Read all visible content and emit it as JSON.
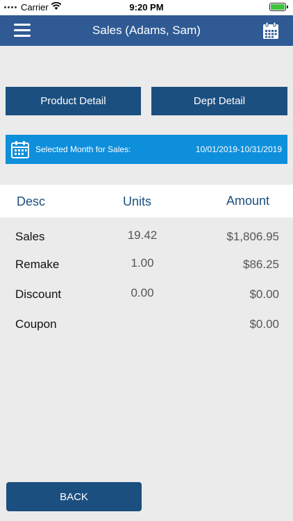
{
  "status_bar": {
    "carrier": "Carrier",
    "time": "9:20 PM",
    "battery_color": "#3ec33e"
  },
  "nav": {
    "title": "Sales (Adams, Sam)",
    "menu_icon": "hamburger-menu-icon",
    "calendar_icon": "calendar-icon"
  },
  "buttons": {
    "product_detail": "Product Detail",
    "dept_detail": "Dept Detail",
    "back": "BACK"
  },
  "month_banner": {
    "label": "Selected Month for Sales:",
    "range": "10/01/2019-10/31/2019",
    "icon": "calendar-icon"
  },
  "table": {
    "headers": {
      "desc": "Desc",
      "units": "Units",
      "amount": "Amount"
    },
    "rows": [
      {
        "desc": "Sales",
        "units": "19.42",
        "amount": "$1,806.95"
      },
      {
        "desc": "Remake",
        "units": "1.00",
        "amount": "$86.25"
      },
      {
        "desc": "Discount",
        "units": "0.00",
        "amount": "$0.00"
      },
      {
        "desc": "Coupon",
        "units": "",
        "amount": "$0.00"
      }
    ]
  },
  "colors": {
    "nav_bar": "#2f5a94",
    "button": "#1b4f80",
    "banner": "#0e8fdc",
    "header_text": "#1b4f80"
  }
}
